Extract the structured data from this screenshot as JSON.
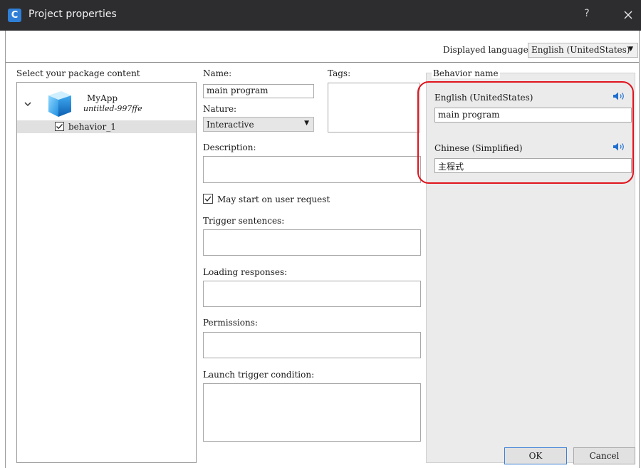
{
  "window": {
    "title": "Project properties",
    "app_icon_letter": "C",
    "help_label": "?"
  },
  "language": {
    "label": "Displayed language",
    "selected": "English (UnitedStates)"
  },
  "package": {
    "label": "Select your package content",
    "app_name": "MyApp",
    "app_id": "untitled-997ffe",
    "behavior": "behavior_1",
    "behavior_checked": true
  },
  "form": {
    "name_label": "Name:",
    "name_value": "main program",
    "tags_label": "Tags:",
    "nature_label": "Nature:",
    "nature_value": "Interactive",
    "description_label": "Description:",
    "may_start_label": "May start on user request",
    "may_start_checked": true,
    "trigger_label": "Trigger sentences:",
    "loading_label": "Loading responses:",
    "permissions_label": "Permissions:",
    "launch_label": "Launch trigger condition:"
  },
  "behavior_name": {
    "label": "Behavior name",
    "languages": [
      {
        "lang": "English (UnitedStates)",
        "value": "main program"
      },
      {
        "lang": "Chinese (Simplified)",
        "value": "主程式"
      }
    ]
  },
  "buttons": {
    "ok": "OK",
    "cancel": "Cancel"
  },
  "colors": {
    "titlebar": "#2d2d30",
    "accent": "#2f7fd7",
    "highlight": "#e0141e",
    "speaker": "#1e6fd0"
  }
}
